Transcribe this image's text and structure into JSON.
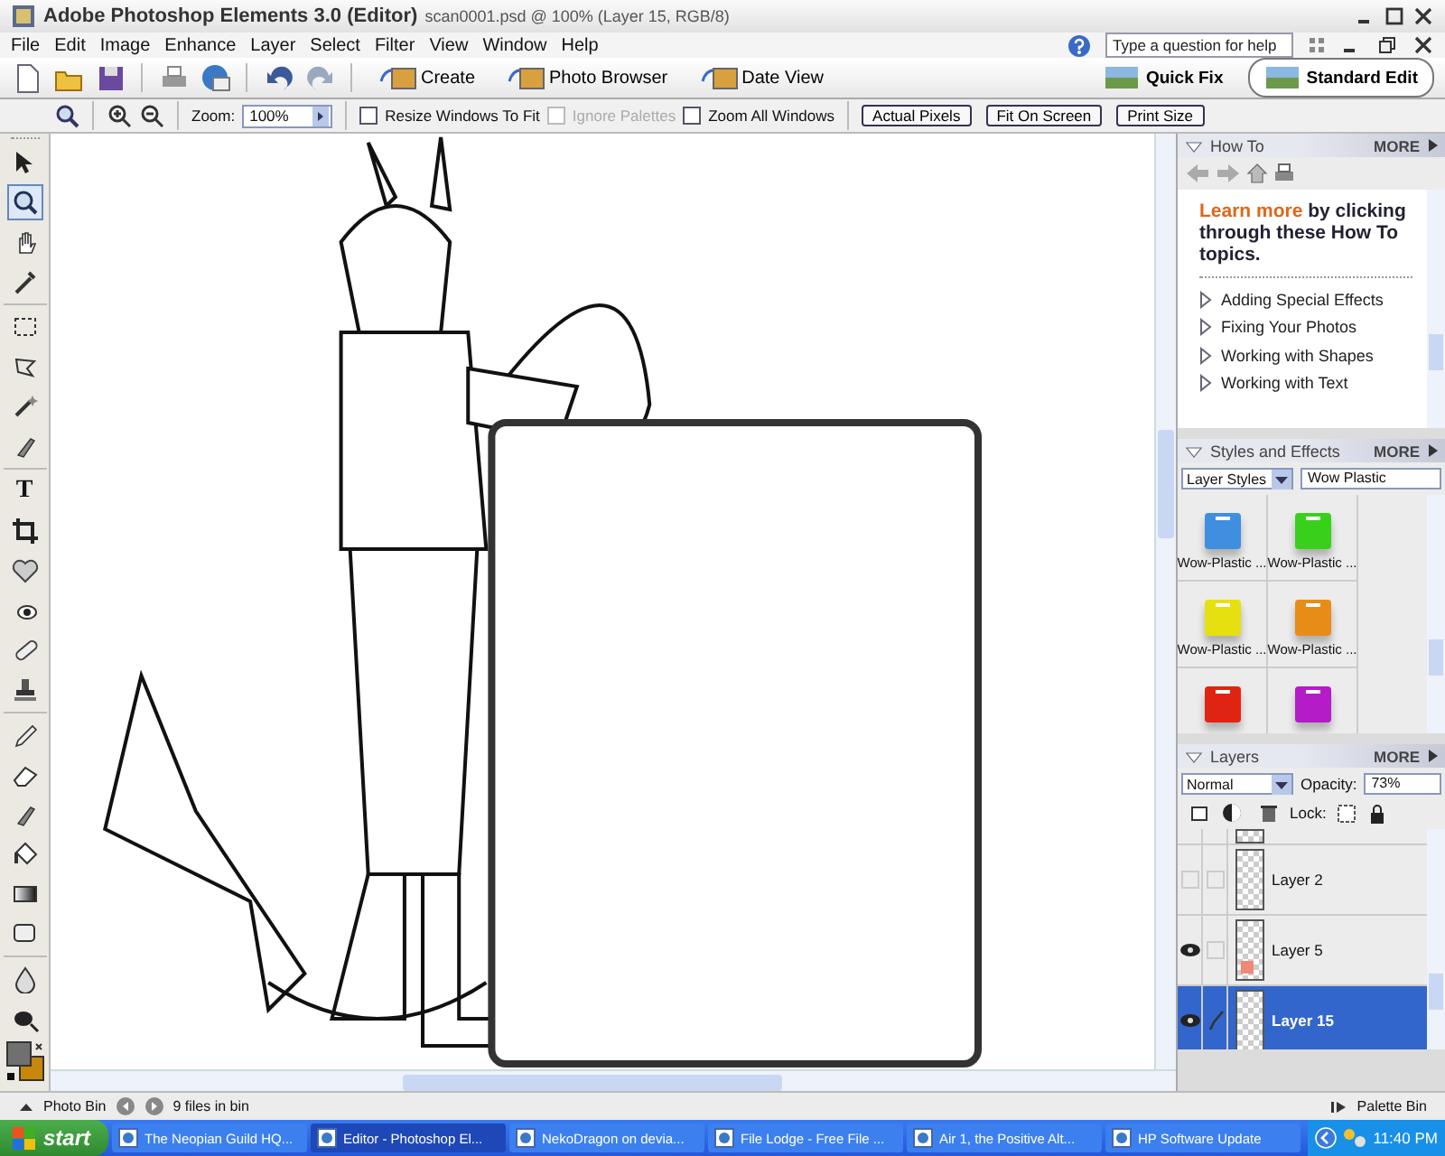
{
  "window": {
    "title": "Adobe Photoshop Elements 3.0 (Editor)",
    "document": "scan0001.psd @ 100% (Layer 15, RGB/8)"
  },
  "menu": [
    "File",
    "Edit",
    "Image",
    "Enhance",
    "Layer",
    "Select",
    "Filter",
    "View",
    "Window",
    "Help"
  ],
  "help": {
    "placeholder": "Type a question for help"
  },
  "toolbar": [
    {
      "kind": "new"
    },
    {
      "kind": "open"
    },
    {
      "kind": "save"
    },
    {
      "kind": "print"
    },
    {
      "kind": "share"
    },
    {
      "kind": "undo"
    },
    {
      "kind": "redo"
    }
  ],
  "shortcuts": [
    "Create",
    "Photo Browser",
    "Date View"
  ],
  "modes": [
    {
      "label": "Quick Fix",
      "selected": false
    },
    {
      "label": "Standard Edit",
      "selected": true
    }
  ],
  "options": {
    "zoom_label": "Zoom:",
    "zoom": "100%",
    "checkboxes": [
      {
        "label": "Resize Windows To Fit",
        "checked": false,
        "disabled": false
      },
      {
        "label": "Ignore Palettes",
        "checked": false,
        "disabled": true
      },
      {
        "label": "Zoom All Windows",
        "checked": false,
        "disabled": false
      }
    ],
    "buttons": [
      "Actual Pixels",
      "Fit On Screen",
      "Print Size"
    ]
  },
  "tools": [
    {
      "kind": "move",
      "selected": false
    },
    {
      "kind": "zoom",
      "selected": true
    },
    {
      "kind": "hand",
      "selected": false
    },
    {
      "kind": "eyedropper",
      "selected": false
    },
    {
      "kind": "marquee",
      "selected": false
    },
    {
      "kind": "lasso",
      "selected": false
    },
    {
      "kind": "wand",
      "selected": false
    },
    {
      "kind": "brush",
      "selected": false
    },
    {
      "kind": "type",
      "glyph": "T",
      "selected": false
    },
    {
      "kind": "crop",
      "selected": false
    },
    {
      "kind": "heart",
      "selected": false
    },
    {
      "kind": "eye",
      "selected": false
    },
    {
      "kind": "bandage",
      "selected": false
    },
    {
      "kind": "stamp",
      "selected": false
    },
    {
      "kind": "pencil",
      "selected": false
    },
    {
      "kind": "eraser",
      "selected": false
    },
    {
      "kind": "brush",
      "selected": false
    },
    {
      "kind": "bucket",
      "selected": false
    },
    {
      "kind": "gradient",
      "selected": false
    },
    {
      "kind": "shape",
      "selected": false
    },
    {
      "kind": "drop",
      "selected": false
    },
    {
      "kind": "sponge",
      "selected": false
    }
  ],
  "how_to": {
    "title": "How To",
    "more": "MORE",
    "lead": "Learn more",
    "text": "by clicking through these How To topics.",
    "topics": [
      "Adding Special Effects",
      "Fixing Your Photos",
      "Working with Shapes",
      "Working with Text"
    ]
  },
  "styles": {
    "title": "Styles and Effects",
    "more": "MORE",
    "category": "Layer Styles",
    "library": "Wow Plastic",
    "items": [
      {
        "label": "Wow-Plastic ...",
        "color": "#3f8ee0"
      },
      {
        "label": "Wow-Plastic ...",
        "color": "#39d01c"
      },
      {
        "label": "Wow-Plastic ...",
        "color": "#e6e010"
      },
      {
        "label": "Wow-Plastic ...",
        "color": "#e88c18"
      },
      {
        "color": "#e02414"
      },
      {
        "color": "#b41cc8"
      }
    ]
  },
  "layers": {
    "title": "Layers",
    "more": "MORE",
    "blend": "Normal",
    "opacity_label": "Opacity:",
    "opacity": "73%",
    "lock_label": "Lock:",
    "items": [
      {
        "name": "Layer 2",
        "visible": false,
        "linked": false,
        "selected": false
      },
      {
        "name": "Layer 5",
        "visible": true,
        "linked": false,
        "selected": false
      },
      {
        "name": "Layer 15",
        "visible": true,
        "linked": true,
        "selected": true
      }
    ]
  },
  "photo_bin": {
    "label": "Photo Bin",
    "count": "9 files in bin",
    "palette_bin": "Palette Bin"
  },
  "taskbar": {
    "start": "start",
    "tasks": [
      {
        "label": "The Neopian Guild HQ...",
        "selected": false
      },
      {
        "label": "Editor - Photoshop El...",
        "selected": true
      },
      {
        "label": "NekoDragon on devia...",
        "selected": false
      },
      {
        "label": "File Lodge - Free File ...",
        "selected": false
      },
      {
        "label": "Air 1, the Positive Alt...",
        "selected": false
      },
      {
        "label": "HP Software Update",
        "selected": false
      }
    ],
    "clock": "11:40 PM"
  }
}
